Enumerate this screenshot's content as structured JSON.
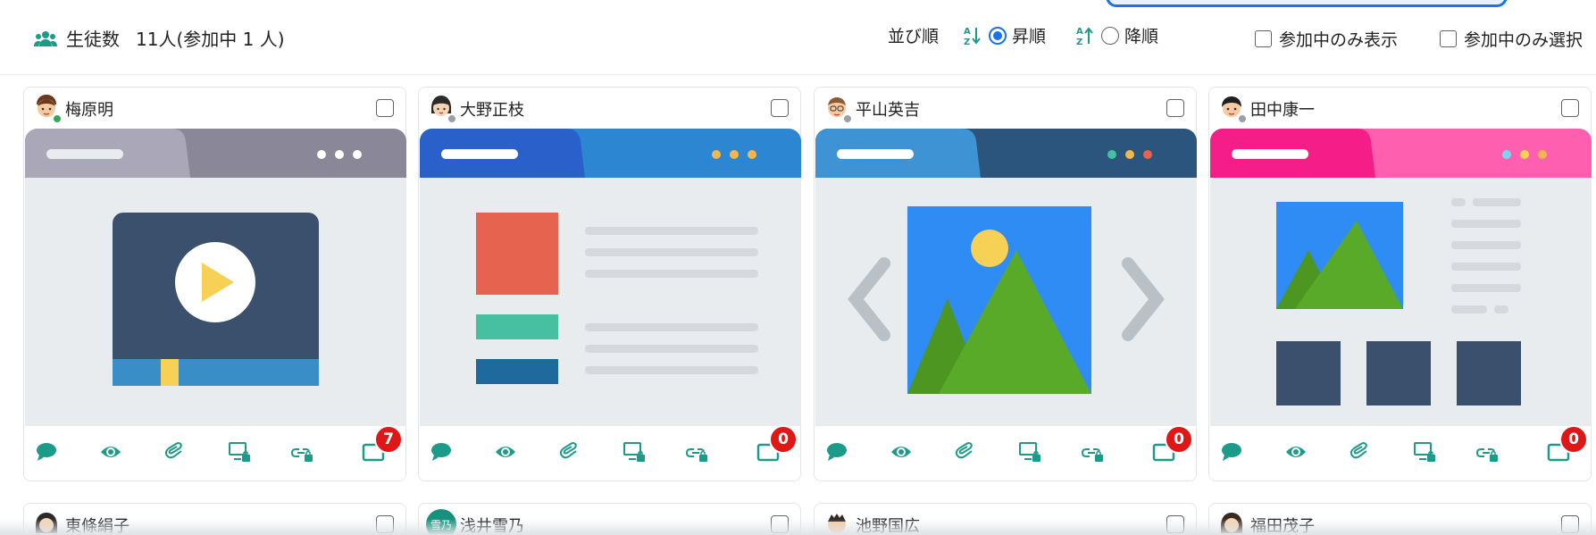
{
  "header": {
    "students_label": "生徒数",
    "students_count": "11人(参加中 1 人)",
    "sort_label": "並び順",
    "asc_label": "昇順",
    "desc_label": "降順",
    "show_only_joined": "参加中のみ表示",
    "select_only_joined": "参加中のみ選択"
  },
  "students": [
    {
      "name": "梅原明",
      "badge": "7",
      "online": true
    },
    {
      "name": "大野正枝",
      "badge": "0",
      "online": false
    },
    {
      "name": "平山英吉",
      "badge": "0",
      "online": false
    },
    {
      "name": "田中康一",
      "badge": "0",
      "online": false
    },
    {
      "name": "東條絹子"
    },
    {
      "name": "浅井雪乃",
      "initials": "雪乃"
    },
    {
      "name": "池野国広"
    },
    {
      "name": "福田茂子"
    }
  ],
  "colors": {
    "accent": "#1a73e8",
    "tool_green": "#1d9b8a",
    "badge_red": "#e01717",
    "online": "#34a853",
    "offline": "#9aa0a6"
  },
  "icons": [
    "students-icon",
    "sort-asc-icon",
    "sort-desc-icon",
    "chat-icon",
    "eye-icon",
    "clip-icon",
    "screen-lock-icon",
    "link-lock-icon",
    "monitor-icon"
  ]
}
